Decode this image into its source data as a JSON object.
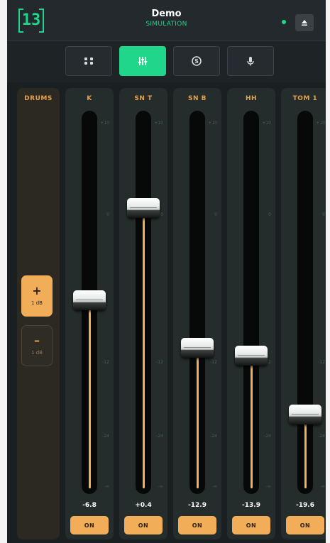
{
  "header": {
    "logo_text": "13",
    "title": "Demo",
    "subtitle": "SIMULATION",
    "status_color": "#1fd68b"
  },
  "tabs": [
    {
      "icon": "grid-icon",
      "active": false
    },
    {
      "icon": "mixer-sliders-icon",
      "active": true
    },
    {
      "icon": "s-coin-icon",
      "active": false
    },
    {
      "icon": "microphone-icon",
      "active": false
    }
  ],
  "group": {
    "label": "DRUMS",
    "plus": {
      "symbol": "+",
      "step": "1 dB"
    },
    "minus": {
      "symbol": "–",
      "step": "1 dB"
    }
  },
  "scale_ticks": [
    "+10",
    "0",
    "-12",
    "-24",
    "-∞"
  ],
  "channels": [
    {
      "label": "K",
      "value": "-6.8",
      "level": 0.51,
      "on_label": "ON"
    },
    {
      "label": "SN T",
      "value": "+0.4",
      "level": 0.76,
      "on_label": "ON"
    },
    {
      "label": "SN B",
      "value": "-12.9",
      "level": 0.38,
      "on_label": "ON"
    },
    {
      "label": "HH",
      "value": "-13.9",
      "level": 0.36,
      "on_label": "ON"
    },
    {
      "label": "TOM 1",
      "value": "-19.6",
      "level": 0.2,
      "on_label": "ON"
    }
  ],
  "colors": {
    "accent_green": "#1fd68b",
    "accent_orange": "#f2ad58",
    "label_orange": "#e5a24c"
  }
}
